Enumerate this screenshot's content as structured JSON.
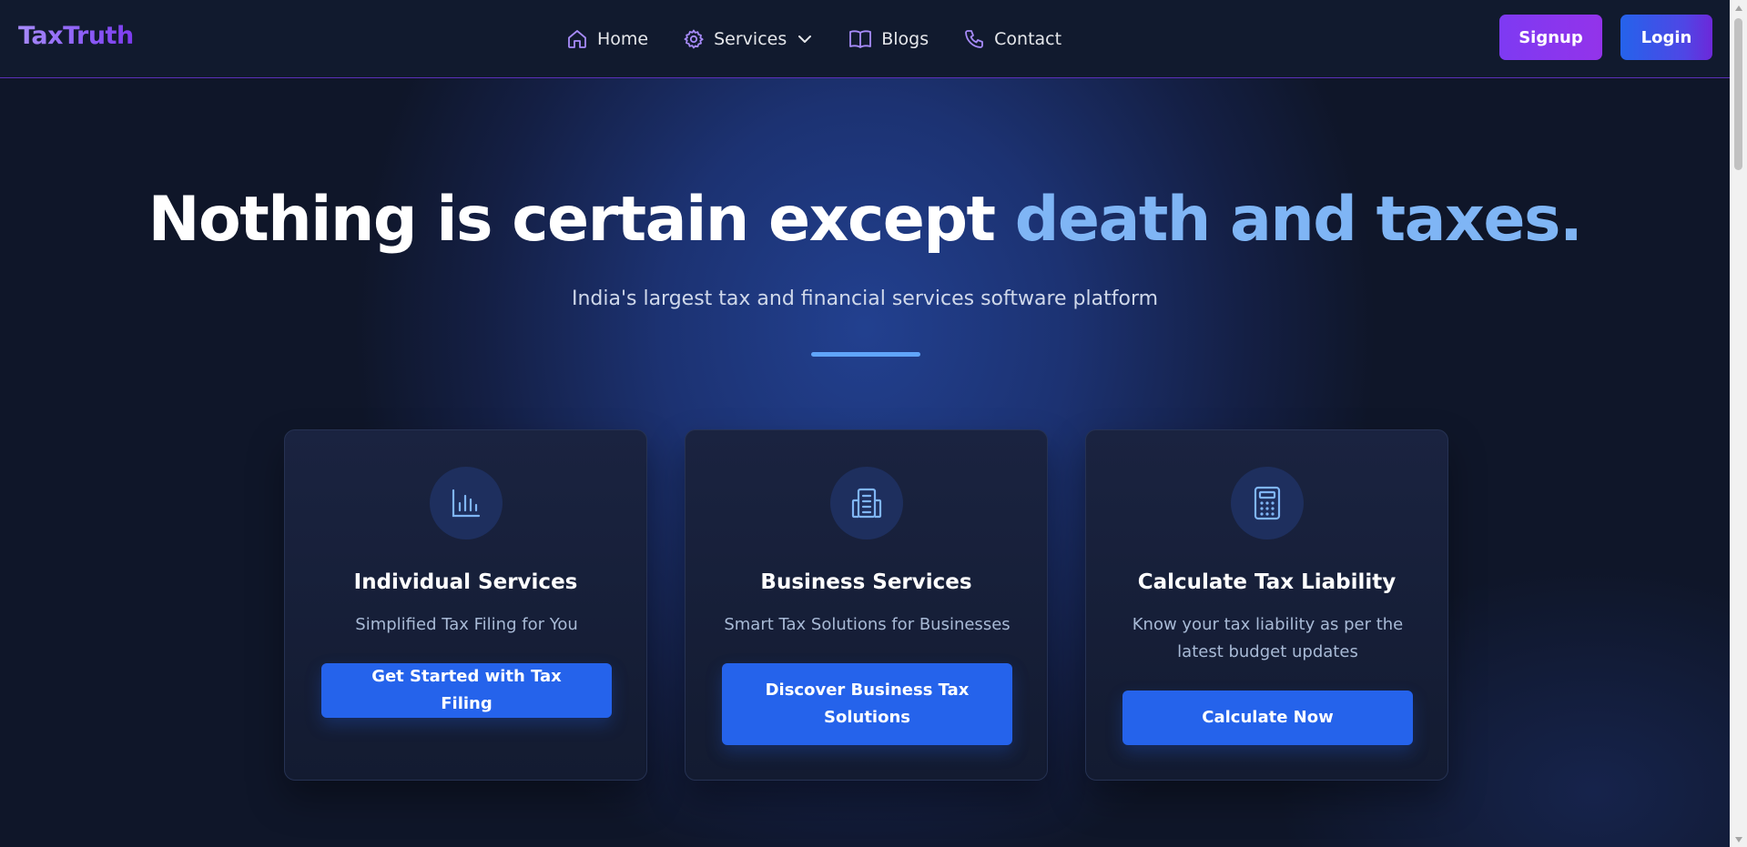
{
  "brand": {
    "name": "TaxTruth"
  },
  "nav": {
    "items": [
      {
        "label": "Home",
        "icon": "home-icon"
      },
      {
        "label": "Services",
        "icon": "gear-icon",
        "dropdown": true
      },
      {
        "label": "Blogs",
        "icon": "book-icon"
      },
      {
        "label": "Contact",
        "icon": "phone-icon"
      }
    ],
    "signup_label": "Signup",
    "login_label": "Login"
  },
  "hero": {
    "title_main": "Nothing is certain except ",
    "title_accent": "death and taxes.",
    "subtitle": "India's largest tax and financial services software platform"
  },
  "cards": [
    {
      "icon": "bar-chart-icon",
      "title": "Individual Services",
      "description": "Simplified Tax Filing for You",
      "button": "Get Started with Tax Filing"
    },
    {
      "icon": "building-icon",
      "title": "Business Services",
      "description": "Smart Tax Solutions for Businesses",
      "button": "Discover Business Tax Solutions"
    },
    {
      "icon": "calculator-icon",
      "title": "Calculate Tax Liability",
      "description": "Know your tax liability as per the latest budget updates",
      "button": "Calculate Now"
    }
  ],
  "colors": {
    "accent_text": "#7fb5f5",
    "primary_button": "#2563eb",
    "signup_button": "#7e3af2",
    "nav_icon": "#a78bfa"
  }
}
